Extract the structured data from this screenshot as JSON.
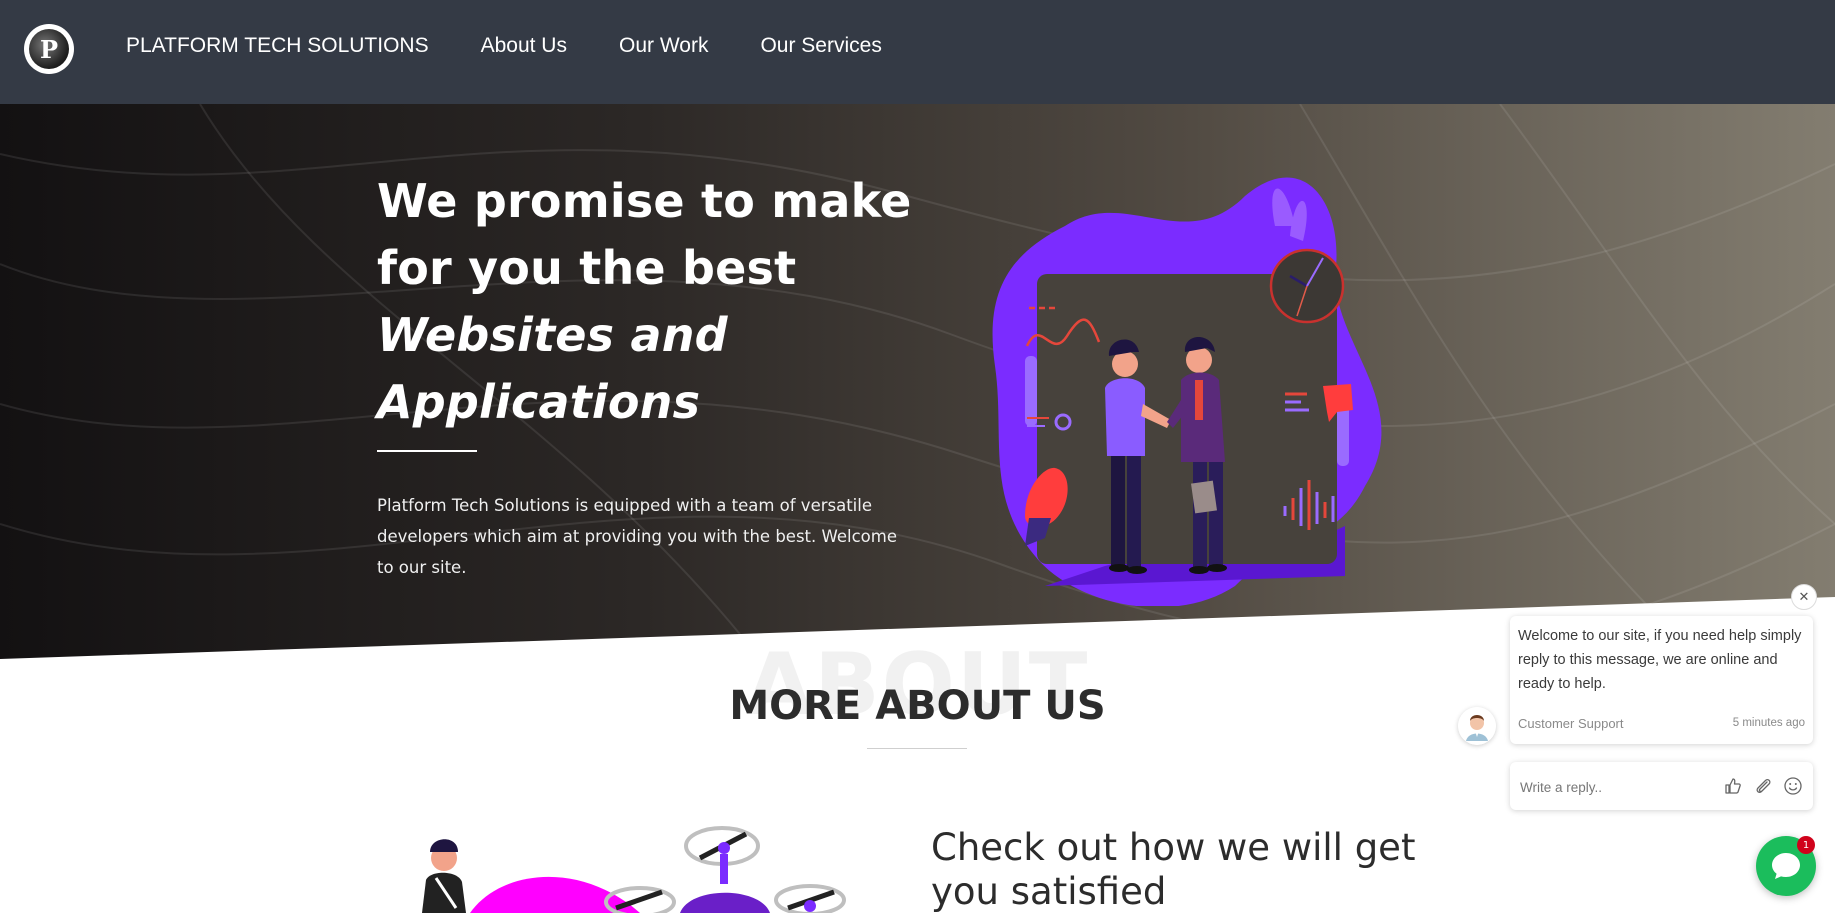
{
  "nav": {
    "brand": "PLATFORM TECH SOLUTIONS",
    "links": [
      "About Us",
      "Our Work",
      "Our Services"
    ]
  },
  "hero": {
    "title_line1": "We promise to make",
    "title_line2": "for you the best",
    "title_line3": "Websites and",
    "title_line4": "Applications",
    "description": "Platform Tech Solutions is equipped with a team of versatile developers which aim at providing you with the best. Welcome to our site."
  },
  "about": {
    "ghost_text": "ABOUT",
    "title": "MORE ABOUT US",
    "subtitle": "Check out how we will get you satisfied"
  },
  "chat": {
    "message": "Welcome to our site, if you need help simply reply to this message, we are online and ready to help.",
    "agent": "Customer Support",
    "time": "5 minutes ago",
    "reply_placeholder": "Write a reply..",
    "badge_count": "1"
  },
  "colors": {
    "nav_bg": "#343a45",
    "accent_purple": "#7b2cff",
    "chat_green": "#1bbd5c",
    "badge_red": "#d0021b"
  }
}
